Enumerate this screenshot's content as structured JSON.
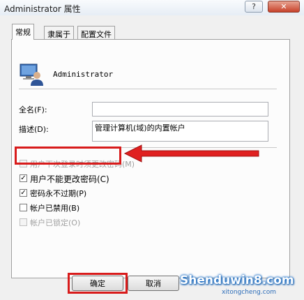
{
  "window": {
    "title": "Administrator 属性",
    "help_glyph": "?",
    "close_glyph": "✕"
  },
  "tabs": [
    "常规",
    "隶属于",
    "配置文件"
  ],
  "general": {
    "user_name": "Administrator",
    "full_name_label": "全名(F):",
    "full_name_value": "",
    "description_label": "描述(D):",
    "description_value": "管理计算机(域)的内置帐户"
  },
  "checkboxes": [
    {
      "label": "用户下次登录时须更改密码(M)",
      "checked": false,
      "disabled": true
    },
    {
      "label": "用户不能更改密码(C)",
      "checked": true,
      "disabled": false
    },
    {
      "label": "密码永不过期(P)",
      "checked": true,
      "disabled": false
    },
    {
      "label": "帐户已禁用(B)",
      "checked": false,
      "disabled": false
    },
    {
      "label": "帐户已锁定(O)",
      "checked": false,
      "disabled": true
    }
  ],
  "buttons": {
    "ok": "确定",
    "cancel": "取消"
  },
  "watermark": {
    "text": "Shenduwin8.com",
    "sub": "xitongcheng.com"
  },
  "colors": {
    "highlight": "#d81b1b",
    "arrow": "#e02020"
  },
  "icons": {
    "user": "user-icon",
    "arrow": "red-arrow-icon"
  }
}
